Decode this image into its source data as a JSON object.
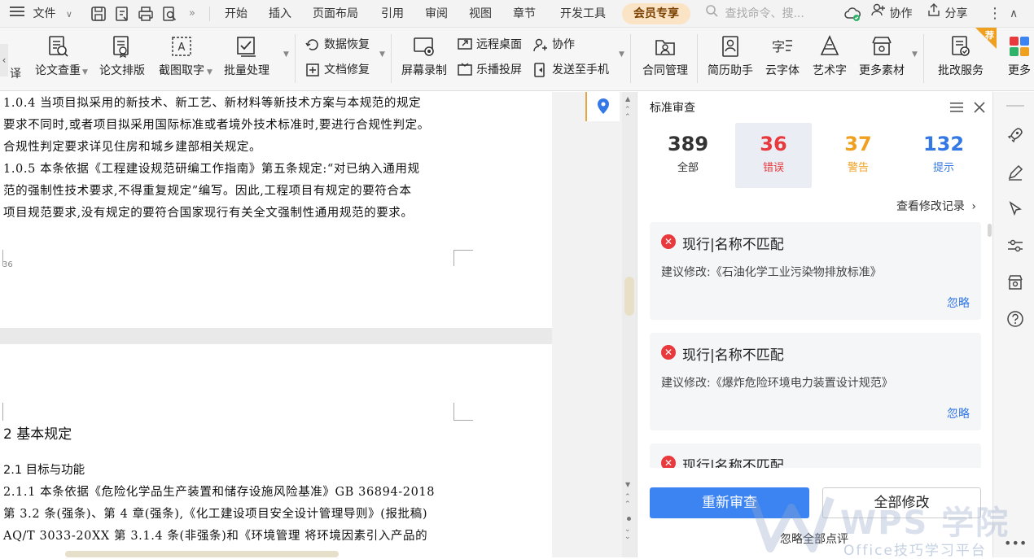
{
  "menubar": {
    "file_label": "文件",
    "tabs": [
      "开始",
      "插入",
      "页面布局",
      "引用",
      "审阅",
      "视图",
      "章节",
      "开发工具"
    ],
    "vip_tab": "会员专享",
    "search_placeholder": "查找命令、搜...",
    "collab_label": "协作",
    "share_label": "分享"
  },
  "ribbon": {
    "left_arrow": "‹",
    "cut_label": "译",
    "buttons": {
      "paper_check": "论文查重",
      "paper_format": "论文排版",
      "screenshot_ocr": "截图取字",
      "batch": "批量处理",
      "data_recover": "数据恢复",
      "doc_repair": "文档修复",
      "screen_record": "屏幕录制",
      "remote_desktop": "远程桌面",
      "cast": "乐播投屏",
      "collab": "协作",
      "send_phone": "发送至手机",
      "contract": "合同管理",
      "resume": "简历助手",
      "cloud_font": "云字体",
      "art_text": "艺术字",
      "more_assets": "更多素材",
      "grading": "批改服务",
      "more": "更多"
    },
    "badge": "荐"
  },
  "document": {
    "lines_page1": [
      "1.0.4  当项目拟采用的新技术、新工艺、新材料等新技术方案与本规范的规定",
      "要求不同时,或者项目拟采用国际标准或者境外技术标准时,要进行合规性判定。",
      "合规性判定要求详见住房和城乡建部相关规定。",
      "1.0.5  本条依据《工程建设规范研编工作指南》第五条规定:“对已纳入通用规",
      "范的强制性技术要求,不得重复规定”编写。因此,工程项目有规定的要符合本",
      "项目规范要求,没有规定的要符合国家现行有关全文强制性通用规范的要求。"
    ],
    "page_number": "36",
    "heading": "2   基本规定",
    "lines_page2": [
      "2.1   目标与功能",
      "2.1.1  本条依据《危险化学品生产装置和储存设施风险基准》GB 36894-2018",
      "第 3.2 条(强条)、第 4 章(强条),《化工建设项目安全设计管理导则》(报批稿)",
      "AQ/T 3033-20XX 第 3.1.4 条(非强条)和《环境管理  将环境因素引入产品的"
    ]
  },
  "panel": {
    "title": "标准审查",
    "stats": [
      {
        "num": "389",
        "label": "全部",
        "color": "#333333"
      },
      {
        "num": "36",
        "label": "错误",
        "color": "#e8393d"
      },
      {
        "num": "37",
        "label": "警告",
        "color": "#f0a020"
      },
      {
        "num": "132",
        "label": "提示",
        "color": "#3478e5"
      }
    ],
    "history_link": "查看修改记录",
    "issues": [
      {
        "title": "现行|名称不匹配",
        "suggestion": "建议修改:《石油化学工业污染物排放标准》",
        "ignore": "忽略"
      },
      {
        "title": "现行|名称不匹配",
        "suggestion": "建议修改:《爆炸危险环境电力装置设计规范》",
        "ignore": "忽略"
      },
      {
        "title": "现行|名称不匹配",
        "suggestion": "",
        "ignore": ""
      }
    ],
    "recheck_button": "重新审查",
    "fix_all_button": "全部修改",
    "ignore_all": "忽略全部点评"
  },
  "watermark": {
    "title": "WPS 学院",
    "subtitle": "Office技巧学习平台"
  },
  "colors": {
    "accent": "#3d84f3",
    "error": "#e8393d",
    "warning": "#f0a020",
    "hint": "#3478e5",
    "vip_bg": "#fbe3c5"
  }
}
